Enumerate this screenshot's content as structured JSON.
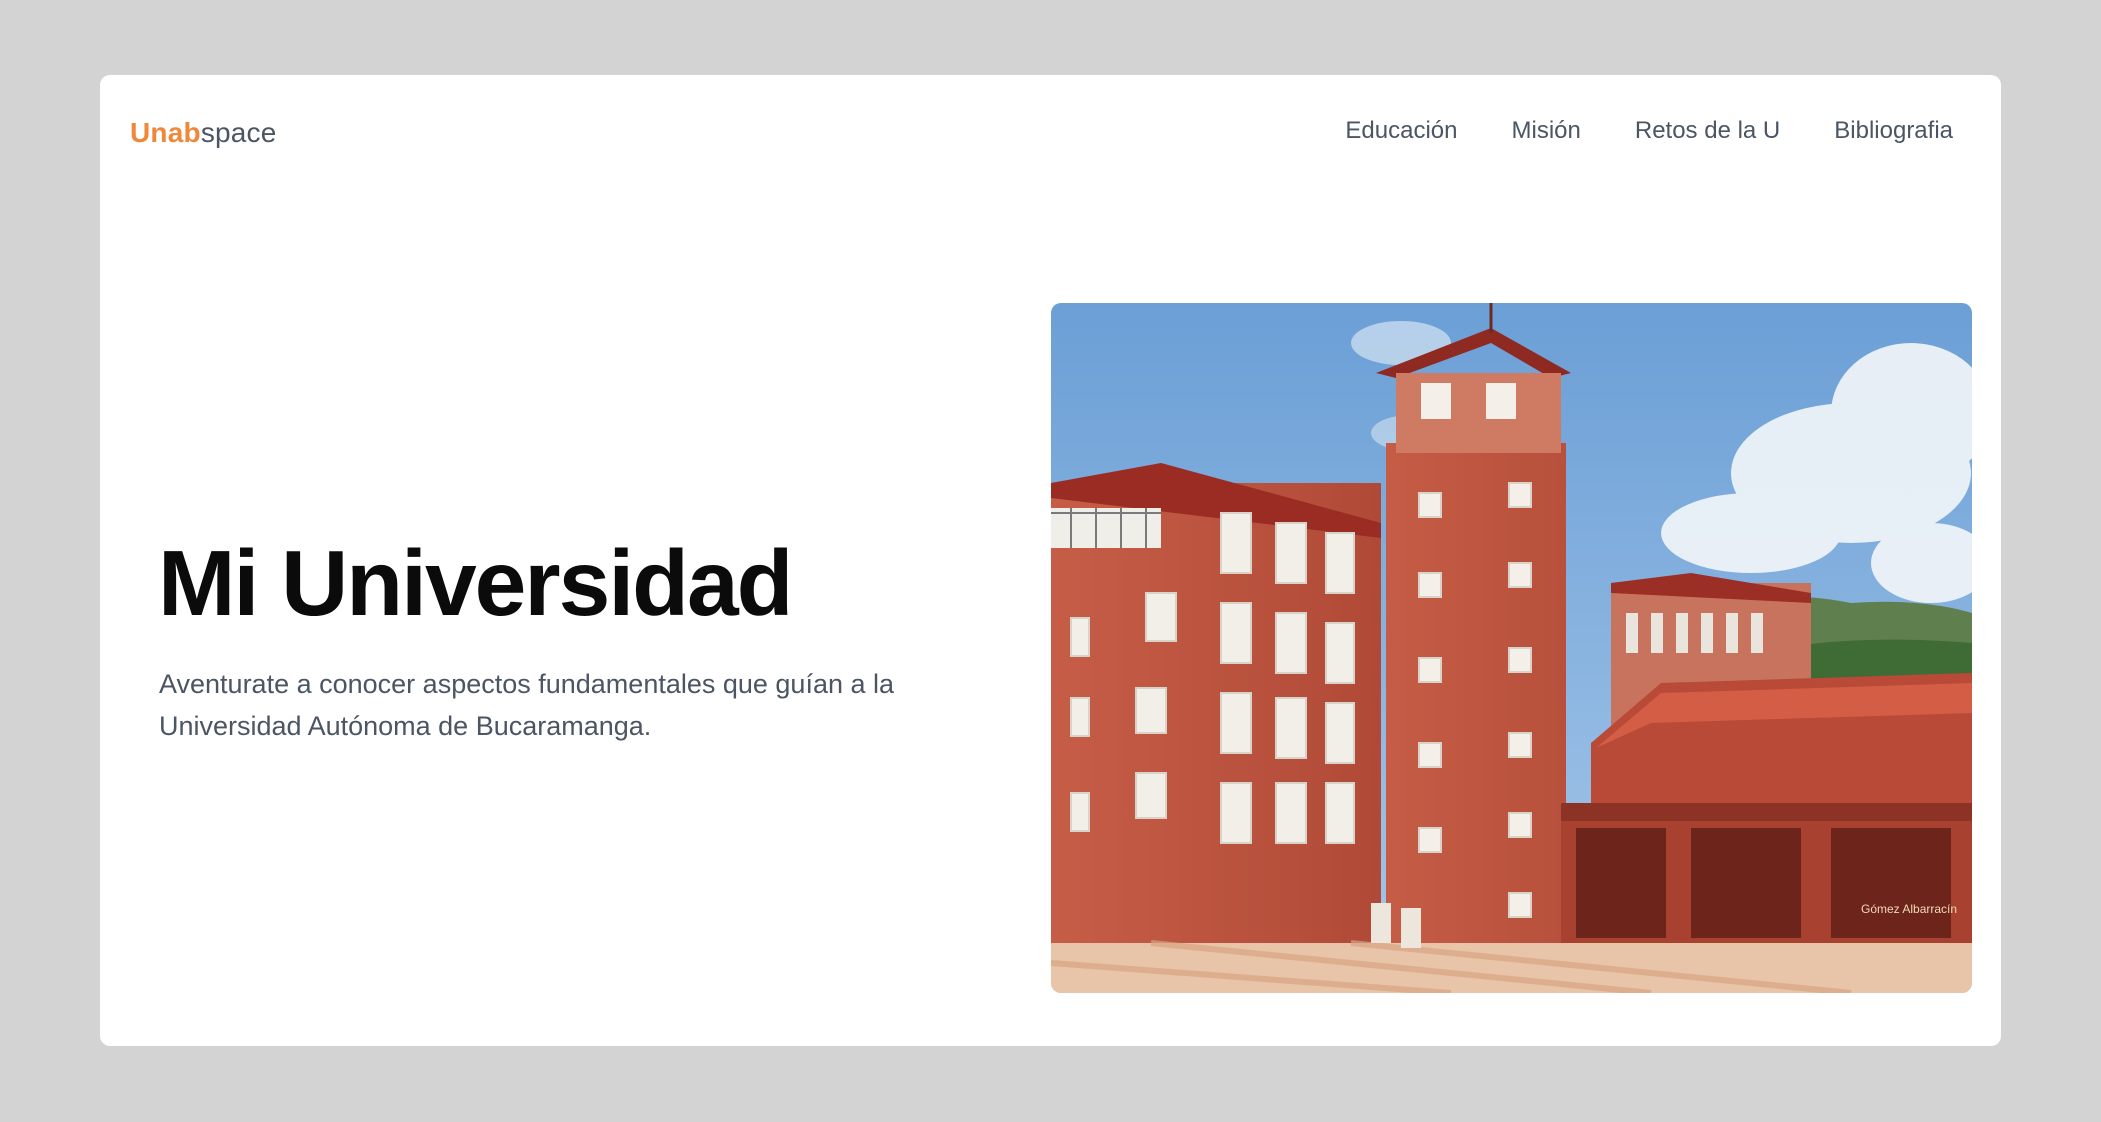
{
  "nav": {
    "logo_accent": "Unab",
    "logo_rest": "space",
    "items": [
      "Educación",
      "Misión",
      "Retos de la U",
      "Bibliografia"
    ]
  },
  "hero": {
    "title": "Mi Universidad",
    "subtitle": "Aventurate a conocer aspectos fundamentales que guían a la Universidad Autónoma de Bucaramanga.",
    "image_sign": "Gómez Albarracín"
  },
  "colors": {
    "brand": "#f0883c",
    "background": "#d3d3d3",
    "card": "#ffffff",
    "text": "#4b5563",
    "title": "#0b0b0b"
  }
}
